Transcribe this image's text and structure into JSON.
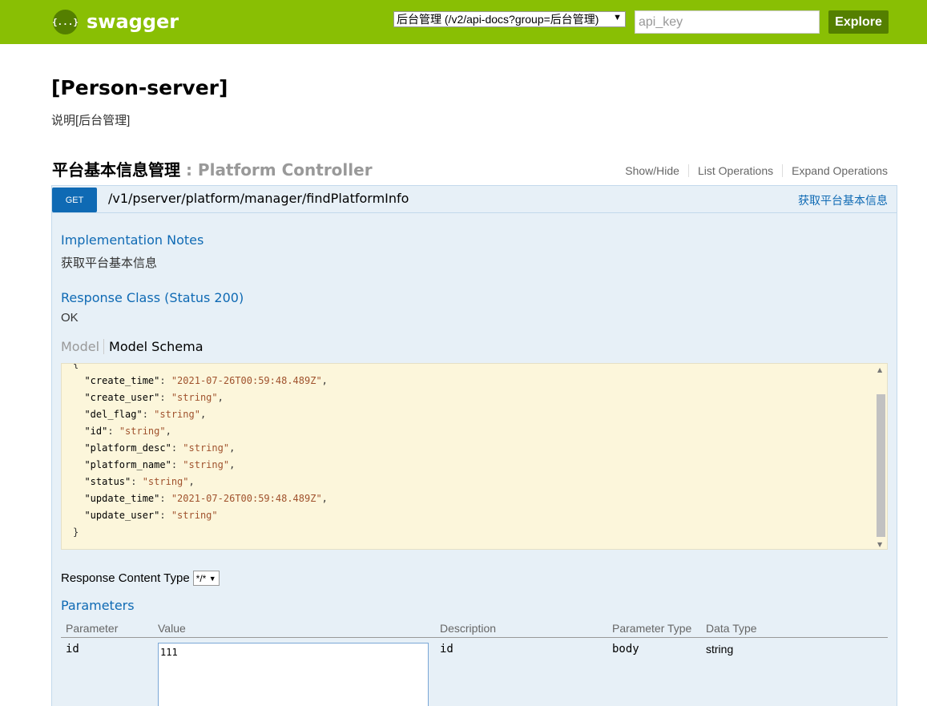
{
  "header": {
    "logo_icon": "{...}",
    "logo_text": "swagger",
    "group_select_value": "后台管理 (/v2/api-docs?group=后台管理)",
    "api_key_placeholder": "api_key",
    "explore_label": "Explore"
  },
  "info": {
    "title": "[Person-server]",
    "description": "说明[后台管理]"
  },
  "resource": {
    "name": "平台基本信息管理",
    "controller": " : Platform Controller",
    "actions": [
      "Show/Hide",
      "List Operations",
      "Expand Operations"
    ]
  },
  "operation": {
    "method": "GET",
    "path": "/v1/pserver/platform/manager/findPlatformInfo",
    "summary": "获取平台基本信息",
    "impl_notes_heading": "Implementation Notes",
    "impl_notes_text": "获取平台基本信息",
    "response_class_heading": "Response Class (Status 200)",
    "response_class_text": "OK",
    "model_tab": "Model",
    "model_schema_tab": "Model Schema",
    "schema_lines": [
      {
        "key": "\"create_time\"",
        "value": "\"2021-07-26T00:59:48.489Z\"",
        "trail": ","
      },
      {
        "key": "\"create_user\"",
        "value": "\"string\"",
        "trail": ","
      },
      {
        "key": "\"del_flag\"",
        "value": "\"string\"",
        "trail": ","
      },
      {
        "key": "\"id\"",
        "value": "\"string\"",
        "trail": ","
      },
      {
        "key": "\"platform_desc\"",
        "value": "\"string\"",
        "trail": ","
      },
      {
        "key": "\"platform_name\"",
        "value": "\"string\"",
        "trail": ","
      },
      {
        "key": "\"status\"",
        "value": "\"string\"",
        "trail": ","
      },
      {
        "key": "\"update_time\"",
        "value": "\"2021-07-26T00:59:48.489Z\"",
        "trail": ","
      },
      {
        "key": "\"update_user\"",
        "value": "\"string\"",
        "trail": ""
      }
    ],
    "response_content_type_label": "Response Content Type",
    "response_content_type_value": "*/*",
    "parameters_heading": "Parameters",
    "param_columns": [
      "Parameter",
      "Value",
      "Description",
      "Parameter Type",
      "Data Type"
    ],
    "params": [
      {
        "name": "id",
        "value": "111",
        "description": "id",
        "param_type": "body",
        "data_type": "string"
      }
    ]
  }
}
